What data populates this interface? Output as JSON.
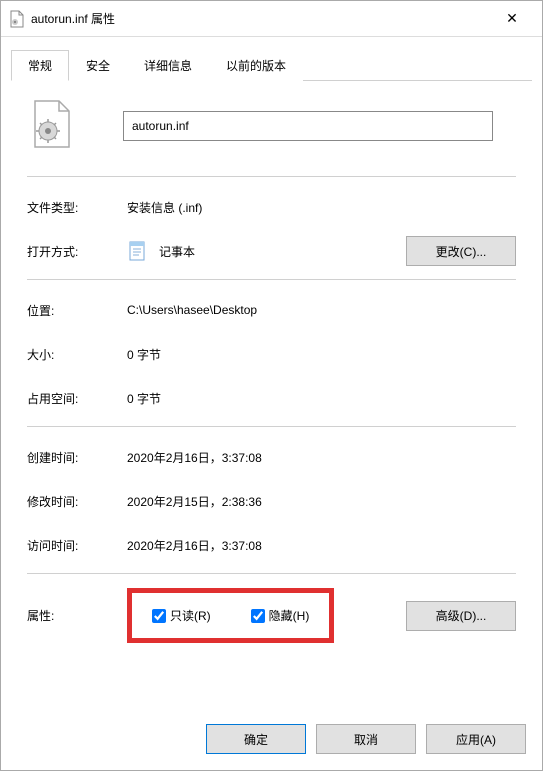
{
  "titlebar": {
    "title": "autorun.inf 属性"
  },
  "tabs": {
    "general": "常规",
    "security": "安全",
    "details": "详细信息",
    "previous": "以前的版本"
  },
  "content": {
    "filename": "autorun.inf",
    "fileTypeLabel": "文件类型:",
    "fileTypeValue": "安装信息 (.inf)",
    "openWithLabel": "打开方式:",
    "openWithValue": "记事本",
    "changeBtn": "更改(C)...",
    "locationLabel": "位置:",
    "locationValue": "C:\\Users\\hasee\\Desktop",
    "sizeLabel": "大小:",
    "sizeValue": "0 字节",
    "sizeOnDiskLabel": "占用空间:",
    "sizeOnDiskValue": "0 字节",
    "createdLabel": "创建时间:",
    "createdValue": "2020年2月16日，3:37:08",
    "modifiedLabel": "修改时间:",
    "modifiedValue": "2020年2月15日，2:38:36",
    "accessedLabel": "访问时间:",
    "accessedValue": "2020年2月16日，3:37:08",
    "attributesLabel": "属性:",
    "readonlyLabel": "只读(R)",
    "hiddenLabel": "隐藏(H)",
    "advancedBtn": "高级(D)..."
  },
  "buttons": {
    "ok": "确定",
    "cancel": "取消",
    "apply": "应用(A)"
  }
}
